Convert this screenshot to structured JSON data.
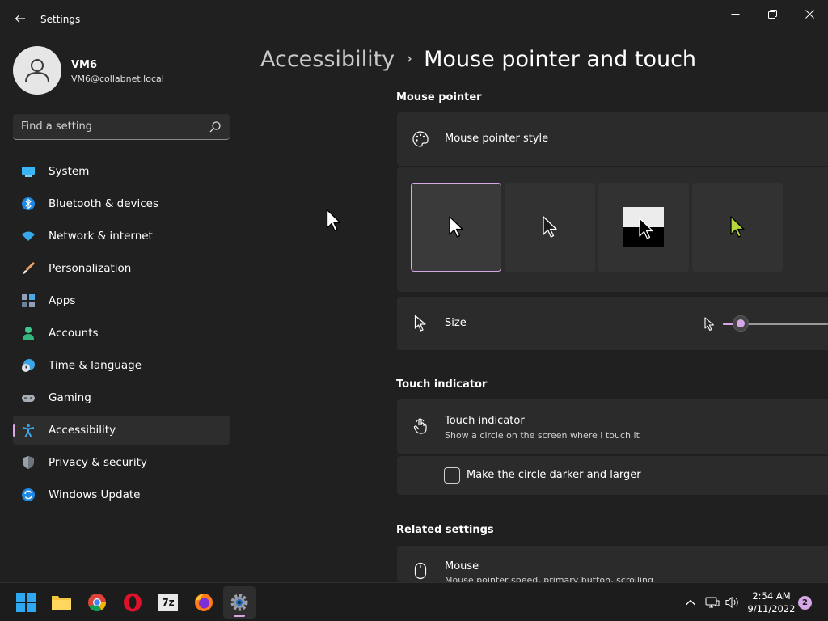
{
  "window": {
    "app_title": "Settings",
    "back_icon": "arrow-left-icon",
    "controls": [
      "minimize-icon",
      "restore-icon",
      "close-icon"
    ]
  },
  "user": {
    "name": "VM6",
    "email": "VM6@collabnet.local"
  },
  "search": {
    "placeholder": "Find a setting",
    "value": ""
  },
  "nav": {
    "items": [
      {
        "label": "System",
        "icon": "monitor-icon",
        "active": false
      },
      {
        "label": "Bluetooth & devices",
        "icon": "bluetooth-icon",
        "active": false
      },
      {
        "label": "Network & internet",
        "icon": "wifi-icon",
        "active": false
      },
      {
        "label": "Personalization",
        "icon": "brush-icon",
        "active": false
      },
      {
        "label": "Apps",
        "icon": "apps-icon",
        "active": false
      },
      {
        "label": "Accounts",
        "icon": "person-icon",
        "active": false
      },
      {
        "label": "Time & language",
        "icon": "clock-globe-icon",
        "active": false
      },
      {
        "label": "Gaming",
        "icon": "gamepad-icon",
        "active": false
      },
      {
        "label": "Accessibility",
        "icon": "accessibility-icon",
        "active": true
      },
      {
        "label": "Privacy & security",
        "icon": "shield-icon",
        "active": false
      },
      {
        "label": "Windows Update",
        "icon": "update-icon",
        "active": false
      }
    ]
  },
  "breadcrumb": {
    "parent": "Accessibility",
    "separator": "›",
    "current": "Mouse pointer and touch"
  },
  "mouse_pointer": {
    "section_title": "Mouse pointer",
    "style_label": "Mouse pointer style",
    "style_options": [
      {
        "name": "white",
        "selected": true
      },
      {
        "name": "black",
        "selected": false
      },
      {
        "name": "inverted",
        "selected": false
      },
      {
        "name": "custom",
        "selected": false,
        "color": "#b5d63a"
      }
    ],
    "size_label": "Size",
    "size_level_fraction": 0.1
  },
  "touch_indicator": {
    "section_title": "Touch indicator",
    "title": "Touch indicator",
    "subtitle": "Show a circle on the screen where I touch it",
    "checkbox_label": "Make the circle darker and larger",
    "checkbox_checked": false
  },
  "related": {
    "section_title": "Related settings",
    "mouse_title": "Mouse",
    "mouse_subtitle": "Mouse pointer speed, primary button, scrolling"
  },
  "taskbar": {
    "apps": [
      "windows-start-icon",
      "file-explorer-icon",
      "chrome-icon",
      "opera-icon",
      "7zip-icon",
      "firefox-icon",
      "settings-icon"
    ],
    "seven_zip_label": "7z",
    "time": "2:54 AM",
    "date": "9/11/2022",
    "notifications": "2"
  },
  "colors": {
    "accent": "#d6a6e6",
    "background": "#202020",
    "card": "#2b2b2b"
  }
}
